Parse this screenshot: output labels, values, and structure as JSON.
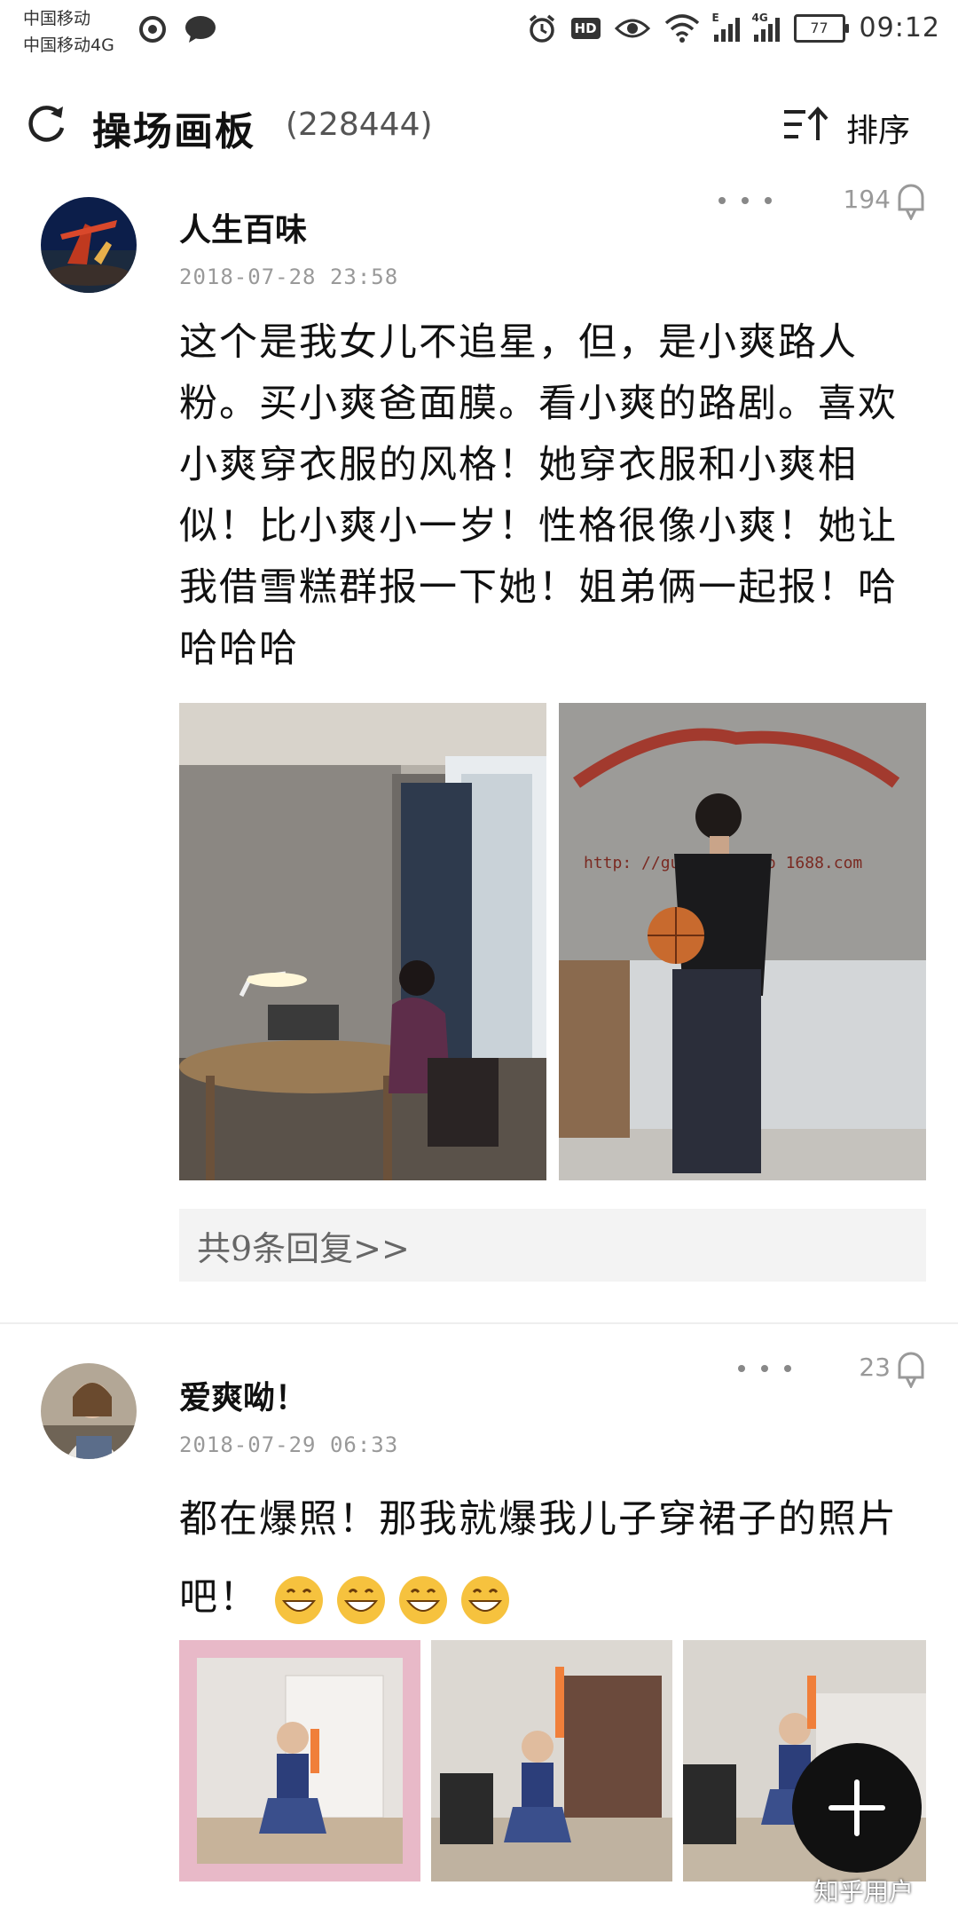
{
  "status_bar": {
    "carrier_1": "中国移动",
    "carrier_2": "中国移动4G",
    "battery": "77",
    "time": "09:12",
    "hd_label": "HD",
    "net_e": "E",
    "net_4g": "4G"
  },
  "header": {
    "title": "操场画板",
    "count": "(228444)",
    "sort_label": "排序"
  },
  "posts": [
    {
      "author": "人生百味",
      "time": "2018-07-28 23:58",
      "count": "194",
      "content": "这个是我女儿不追星，但，是小爽路人粉。买小爽爸面膜。看小爽的路剧。喜欢小爽穿衣服的风格！她穿衣服和小爽相似！比小爽小一岁！性格很像小爽！她让我借雪糕群报一下她！姐弟俩一起报！哈哈哈哈",
      "photo_text": "http: //guan  nsujiao 1688.com",
      "replies": "共9条回复>>"
    },
    {
      "author": "爱爽呦！",
      "time": "2018-07-29 06:33",
      "count": "23",
      "content": "都在爆照！那我就爆我儿子穿裙子的照片吧！"
    }
  ],
  "watermark": "知乎用户",
  "icons": {
    "refresh": "refresh-icon",
    "sort": "sort-icon",
    "more": "more-icon",
    "comment": "comment-bubble-icon",
    "add": "plus-icon"
  }
}
